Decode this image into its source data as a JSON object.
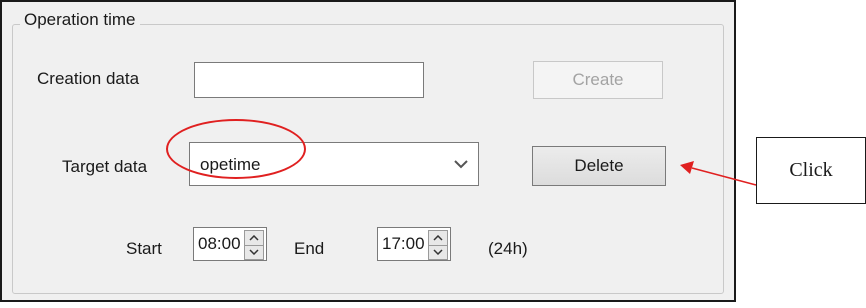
{
  "group": {
    "title": "Operation time"
  },
  "creation": {
    "label": "Creation data",
    "value": "",
    "create_button": "Create"
  },
  "target": {
    "label": "Target data",
    "selected": "opetime",
    "delete_button": "Delete"
  },
  "time": {
    "start_label": "Start",
    "start_value": "08:00",
    "end_label": "End",
    "end_value": "17:00",
    "unit_label": "(24h)"
  },
  "annotation": {
    "callout_text": "Click",
    "highlight_color": "#e02020"
  }
}
